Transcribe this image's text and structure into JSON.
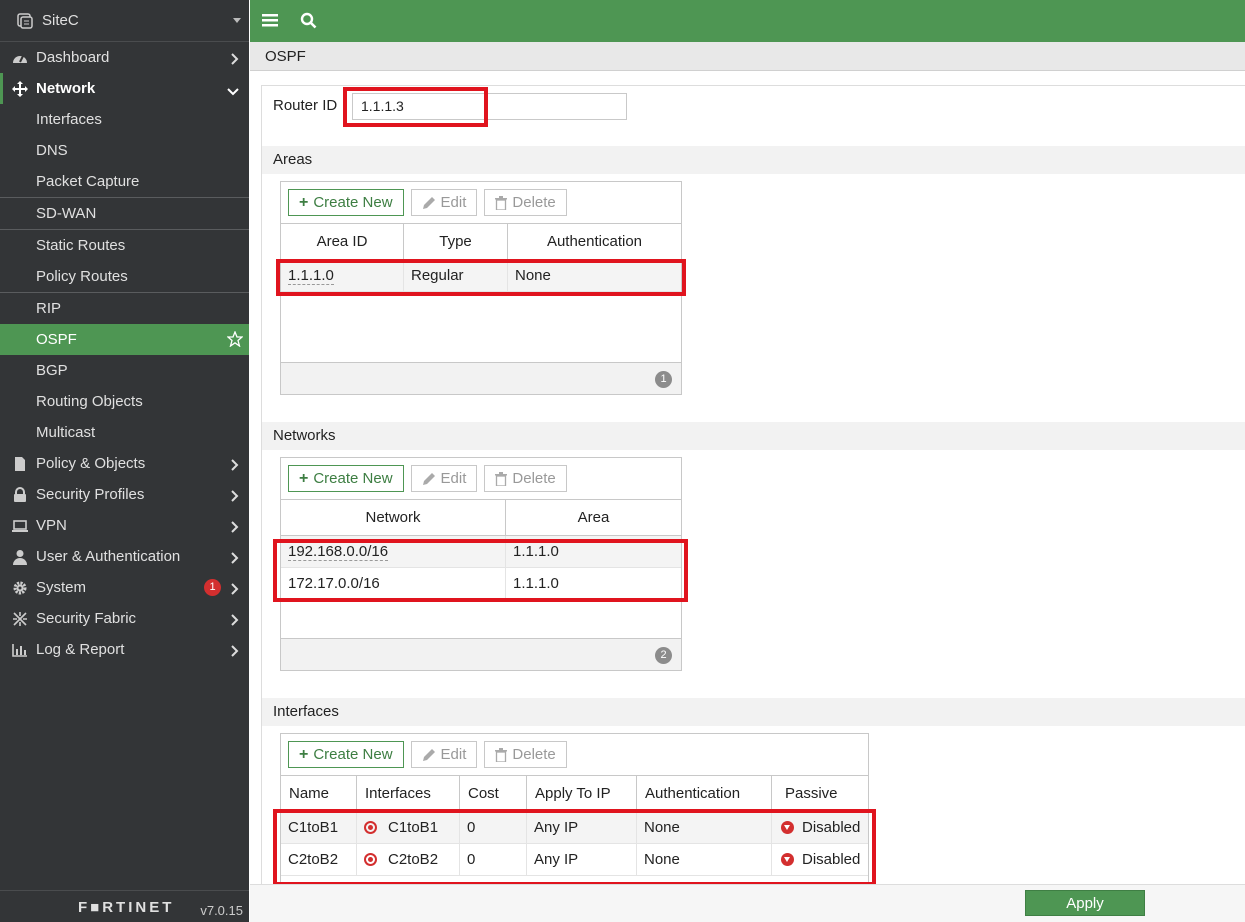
{
  "sidebar": {
    "device": "SiteC",
    "items": [
      {
        "label": "Dashboard"
      },
      {
        "label": "Network"
      },
      {
        "label": "Interfaces"
      },
      {
        "label": "DNS"
      },
      {
        "label": "Packet Capture"
      },
      {
        "label": "SD-WAN"
      },
      {
        "label": "Static Routes"
      },
      {
        "label": "Policy Routes"
      },
      {
        "label": "RIP"
      },
      {
        "label": "OSPF"
      },
      {
        "label": "BGP"
      },
      {
        "label": "Routing Objects"
      },
      {
        "label": "Multicast"
      },
      {
        "label": "Policy & Objects"
      },
      {
        "label": "Security Profiles"
      },
      {
        "label": "VPN"
      },
      {
        "label": "User & Authentication"
      },
      {
        "label": "System",
        "badge": "1"
      },
      {
        "label": "Security Fabric"
      },
      {
        "label": "Log & Report"
      }
    ],
    "brand": "F■RTINET",
    "version": "v7.0.15"
  },
  "page_title": "OSPF",
  "router_id": {
    "label": "Router ID",
    "value": "1.1.1.3"
  },
  "toolbar": {
    "create": "Create New",
    "edit": "Edit",
    "delete": "Delete"
  },
  "areas": {
    "title": "Areas",
    "columns": [
      "Area ID",
      "Type",
      "Authentication"
    ],
    "rows": [
      [
        "1.1.1.0",
        "Regular",
        "None"
      ]
    ],
    "count": "1"
  },
  "networks": {
    "title": "Networks",
    "columns": [
      "Network",
      "Area"
    ],
    "rows": [
      [
        "192.168.0.0/16",
        "1.1.1.0"
      ],
      [
        "172.17.0.0/16",
        "1.1.1.0"
      ]
    ],
    "count": "2"
  },
  "interfaces": {
    "title": "Interfaces",
    "columns": [
      "Name",
      "Interfaces",
      "Cost",
      "Apply To IP",
      "Authentication",
      "Passive"
    ],
    "rows": [
      [
        "C1toB1",
        "C1toB1",
        "0",
        "Any IP",
        "None",
        "Disabled"
      ],
      [
        "C2toB2",
        "C2toB2",
        "0",
        "Any IP",
        "None",
        "Disabled"
      ]
    ]
  },
  "apply_label": "Apply",
  "colors": {
    "accent": "#4e9653",
    "highlight": "#e0141e",
    "sidebar": "#333537"
  }
}
